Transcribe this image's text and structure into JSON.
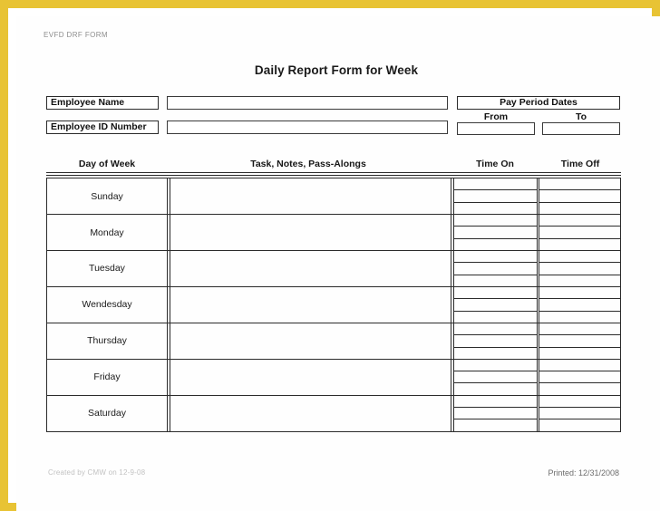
{
  "page": {
    "doc_code": "EVFD DRF FORM",
    "title": "Daily Report Form for Week",
    "border_color": "#e8c334",
    "paper_color": "#ffffff"
  },
  "employee": {
    "name_label": "Employee Name",
    "name_value": "",
    "id_label": "Employee ID Number",
    "id_value": ""
  },
  "pay_period": {
    "header": "Pay Period Dates",
    "from_label": "From",
    "from_value": "",
    "to_label": "To",
    "to_value": ""
  },
  "table": {
    "headers": {
      "day": "Day of Week",
      "task": "Task, Notes, Pass-Alongs",
      "time_on": "Time On",
      "time_off": "Time Off"
    },
    "slots_per_day": 3,
    "rows": [
      {
        "day": "Sunday",
        "task": "",
        "time_on": [
          "",
          "",
          ""
        ],
        "time_off": [
          "",
          "",
          ""
        ]
      },
      {
        "day": "Monday",
        "task": "",
        "time_on": [
          "",
          "",
          ""
        ],
        "time_off": [
          "",
          "",
          ""
        ]
      },
      {
        "day": "Tuesday",
        "task": "",
        "time_on": [
          "",
          "",
          ""
        ],
        "time_off": [
          "",
          "",
          ""
        ]
      },
      {
        "day": "Wendesday",
        "task": "",
        "time_on": [
          "",
          "",
          ""
        ],
        "time_off": [
          "",
          "",
          ""
        ]
      },
      {
        "day": "Thursday",
        "task": "",
        "time_on": [
          "",
          "",
          ""
        ],
        "time_off": [
          "",
          "",
          ""
        ]
      },
      {
        "day": "Friday",
        "task": "",
        "time_on": [
          "",
          "",
          ""
        ],
        "time_off": [
          "",
          "",
          ""
        ]
      },
      {
        "day": "Saturday",
        "task": "",
        "time_on": [
          "",
          "",
          ""
        ],
        "time_off": [
          "",
          "",
          ""
        ]
      }
    ]
  },
  "footer": {
    "created": "Created by CMW on 12-9-08",
    "printed": "Printed: 12/31/2008"
  }
}
